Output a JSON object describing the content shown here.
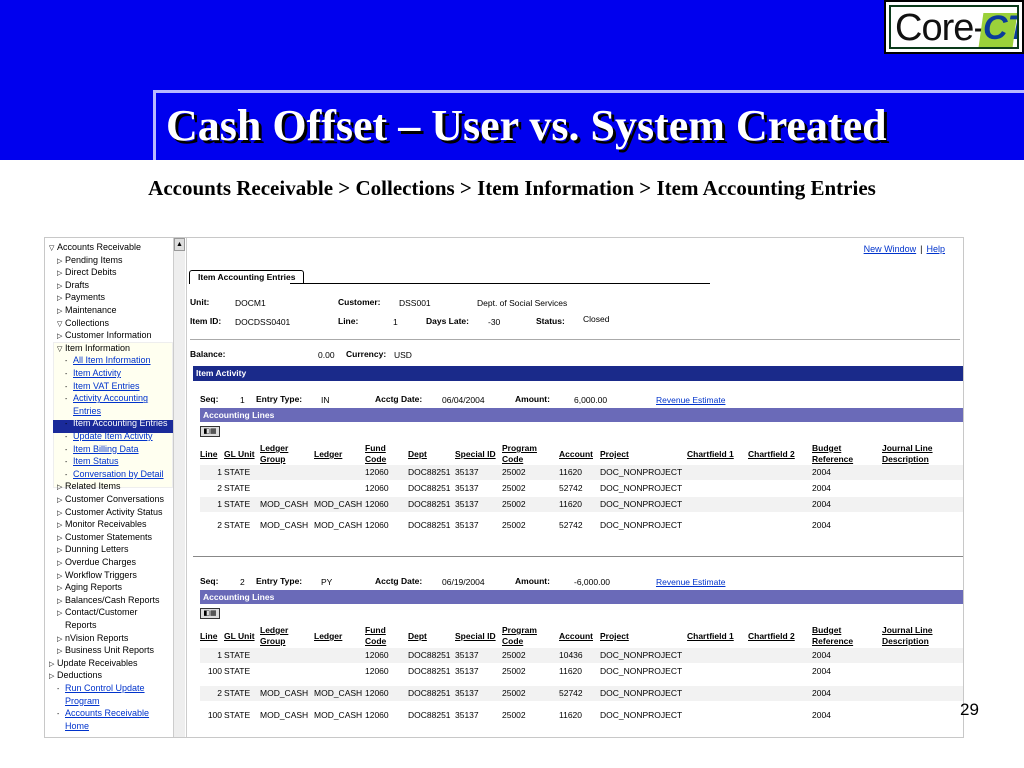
{
  "slide": {
    "title": "Cash Offset – User vs. System Created",
    "breadcrumb": "Accounts Receivable > Collections > Item Information > Item Accounting Entries",
    "page_number": "29",
    "logo_core": "Core-",
    "logo_ct": "CT"
  },
  "nav": {
    "items": [
      {
        "label": "Accounts Receivable",
        "tri": "▽"
      },
      {
        "label": "Pending Items",
        "tri": "▷"
      },
      {
        "label": "Direct Debits",
        "tri": "▷"
      },
      {
        "label": "Drafts",
        "tri": "▷"
      },
      {
        "label": "Payments",
        "tri": "▷"
      },
      {
        "label": "Maintenance",
        "tri": "▷"
      },
      {
        "label": "Collections",
        "tri": "▽"
      },
      {
        "label": "Customer Information",
        "tri": "▷"
      },
      {
        "label": "Item Information",
        "tri": "▽"
      },
      {
        "label": "All Item Information",
        "tri": "-"
      },
      {
        "label": "Item Activity",
        "tri": "-"
      },
      {
        "label": "Item VAT Entries",
        "tri": "-"
      },
      {
        "label": "Activity Accounting",
        "tri": "-"
      },
      {
        "label": "Entries",
        "tri": ""
      },
      {
        "label": "Item Accounting Entries",
        "tri": "-"
      },
      {
        "label": "Update Item Activity",
        "tri": "-"
      },
      {
        "label": "Item Billing Data",
        "tri": "-"
      },
      {
        "label": "Item Status",
        "tri": "-"
      },
      {
        "label": "Conversation by Detail",
        "tri": "-"
      },
      {
        "label": "Related Items",
        "tri": "▷"
      },
      {
        "label": "Customer Conversations",
        "tri": "▷"
      },
      {
        "label": "Customer Activity Status",
        "tri": "▷"
      },
      {
        "label": "Monitor Receivables",
        "tri": "▷"
      },
      {
        "label": "Customer Statements",
        "tri": "▷"
      },
      {
        "label": "Dunning Letters",
        "tri": "▷"
      },
      {
        "label": "Overdue Charges",
        "tri": "▷"
      },
      {
        "label": "Workflow Triggers",
        "tri": "▷"
      },
      {
        "label": "Aging Reports",
        "tri": "▷"
      },
      {
        "label": "Balances/Cash Reports",
        "tri": "▷"
      },
      {
        "label": "Contact/Customer",
        "tri": "▷"
      },
      {
        "label": "Reports",
        "tri": ""
      },
      {
        "label": "nVision Reports",
        "tri": "▷"
      },
      {
        "label": "Business Unit Reports",
        "tri": "▷"
      },
      {
        "label": "Update Receivables",
        "tri": "▷"
      },
      {
        "label": "Deductions",
        "tri": "▷"
      },
      {
        "label": "Run Control Update",
        "tri": "-"
      },
      {
        "label": "Program",
        "tri": ""
      },
      {
        "label": "Accounts Receivable",
        "tri": "-"
      },
      {
        "label": "Home",
        "tri": ""
      }
    ]
  },
  "toplinks": {
    "new_window": "New Window",
    "help": "Help",
    "sep": "|"
  },
  "page": {
    "tab": "Item Accounting Entries",
    "unit_label": "Unit:",
    "unit": "DOCM1",
    "customer_label": "Customer:",
    "customer": "DSS001",
    "customer_name": "Dept. of Social Services",
    "item_label": "Item ID:",
    "item": "DOCDSS0401",
    "line_label": "Line:",
    "line": "1",
    "days_late_label": "Days Late:",
    "days_late": "-30",
    "status_label": "Status:",
    "status": "Closed",
    "balance_label": "Balance:",
    "balance": "0.00",
    "currency_label": "Currency:",
    "currency": "USD",
    "item_activity": "Item Activity"
  },
  "headers": {
    "line": "Line",
    "gl_unit": "GL Unit",
    "ledger_group_1": "Ledger",
    "ledger_group_2": "Group",
    "ledger": "Ledger",
    "fund_code_1": "Fund",
    "fund_code_2": "Code",
    "dept": "Dept",
    "special_id": "Special ID",
    "program_code_1": "Program",
    "program_code_2": "Code",
    "account": "Account",
    "project": "Project",
    "chartfield1": "Chartfield 1",
    "chartfield2": "Chartfield 2",
    "budget_ref_1": "Budget",
    "budget_ref_2": "Reference",
    "journal_desc_1": "Journal Line",
    "journal_desc_2": "Description"
  },
  "activities": [
    {
      "seq_label": "Seq:",
      "seq": "1",
      "entry_type_label": "Entry Type:",
      "entry_type": "IN",
      "acctg_date_label": "Acctg Date:",
      "acctg_date": "06/04/2004",
      "amount_label": "Amount:",
      "amount": "6,000.00",
      "link": "Revenue Estimate",
      "accounting_lines": "Accounting Lines",
      "rows": [
        {
          "line": "1",
          "gl_unit": "STATE",
          "ledger_group": "",
          "ledger": "",
          "fund": "12060",
          "dept": "DOC88251",
          "special_id": "35137",
          "program": "25002",
          "account": "11620",
          "project": "DOC_NONPROJECT",
          "budget_ref": "2004"
        },
        {
          "line": "2",
          "gl_unit": "STATE",
          "ledger_group": "",
          "ledger": "",
          "fund": "12060",
          "dept": "DOC88251",
          "special_id": "35137",
          "program": "25002",
          "account": "52742",
          "project": "DOC_NONPROJECT",
          "budget_ref": "2004"
        },
        {
          "line": "1",
          "gl_unit": "STATE",
          "ledger_group": "MOD_CASH",
          "ledger": "MOD_CASH",
          "fund": "12060",
          "dept": "DOC88251",
          "special_id": "35137",
          "program": "25002",
          "account": "11620",
          "project": "DOC_NONPROJECT",
          "budget_ref": "2004"
        },
        {
          "line": "2",
          "gl_unit": "STATE",
          "ledger_group": "MOD_CASH",
          "ledger": "MOD_CASH",
          "fund": "12060",
          "dept": "DOC88251",
          "special_id": "35137",
          "program": "25002",
          "account": "52742",
          "project": "DOC_NONPROJECT",
          "budget_ref": "2004"
        }
      ]
    },
    {
      "seq_label": "Seq:",
      "seq": "2",
      "entry_type_label": "Entry Type:",
      "entry_type": "PY",
      "acctg_date_label": "Acctg Date:",
      "acctg_date": "06/19/2004",
      "amount_label": "Amount:",
      "amount": "-6,000.00",
      "link": "Revenue Estimate",
      "accounting_lines": "Accounting Lines",
      "rows": [
        {
          "line": "1",
          "gl_unit": "STATE",
          "ledger_group": "",
          "ledger": "",
          "fund": "12060",
          "dept": "DOC88251",
          "special_id": "35137",
          "program": "25002",
          "account": "10436",
          "project": "DOC_NONPROJECT",
          "budget_ref": "2004"
        },
        {
          "line": "100",
          "gl_unit": "STATE",
          "ledger_group": "",
          "ledger": "",
          "fund": "12060",
          "dept": "DOC88251",
          "special_id": "35137",
          "program": "25002",
          "account": "11620",
          "project": "DOC_NONPROJECT",
          "budget_ref": "2004"
        },
        {
          "line": "2",
          "gl_unit": "STATE",
          "ledger_group": "MOD_CASH",
          "ledger": "MOD_CASH",
          "fund": "12060",
          "dept": "DOC88251",
          "special_id": "35137",
          "program": "25002",
          "account": "52742",
          "project": "DOC_NONPROJECT",
          "budget_ref": "2004"
        },
        {
          "line": "100",
          "gl_unit": "STATE",
          "ledger_group": "MOD_CASH",
          "ledger": "MOD_CASH",
          "fund": "12060",
          "dept": "DOC88251",
          "special_id": "35137",
          "program": "25002",
          "account": "11620",
          "project": "DOC_NONPROJECT",
          "budget_ref": "2004"
        }
      ]
    }
  ]
}
